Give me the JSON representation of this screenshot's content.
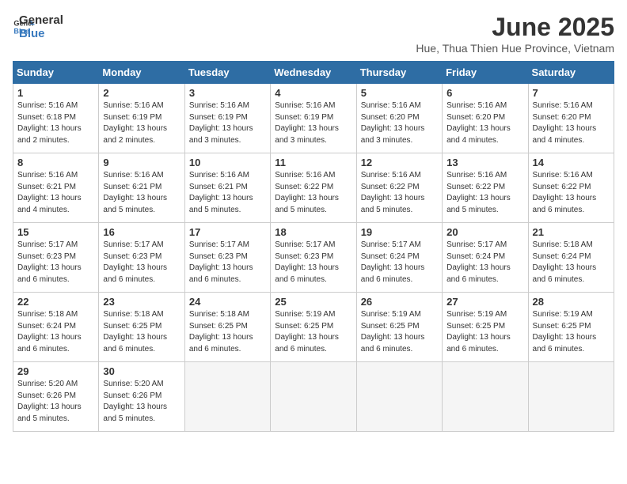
{
  "logo": {
    "general": "General",
    "blue": "Blue"
  },
  "title": "June 2025",
  "location": "Hue, Thua Thien Hue Province, Vietnam",
  "weekdays": [
    "Sunday",
    "Monday",
    "Tuesday",
    "Wednesday",
    "Thursday",
    "Friday",
    "Saturday"
  ],
  "weeks": [
    [
      {
        "day": "1",
        "sunrise": "5:16 AM",
        "sunset": "6:18 PM",
        "daylight": "13 hours and 2 minutes."
      },
      {
        "day": "2",
        "sunrise": "5:16 AM",
        "sunset": "6:19 PM",
        "daylight": "13 hours and 2 minutes."
      },
      {
        "day": "3",
        "sunrise": "5:16 AM",
        "sunset": "6:19 PM",
        "daylight": "13 hours and 3 minutes."
      },
      {
        "day": "4",
        "sunrise": "5:16 AM",
        "sunset": "6:19 PM",
        "daylight": "13 hours and 3 minutes."
      },
      {
        "day": "5",
        "sunrise": "5:16 AM",
        "sunset": "6:20 PM",
        "daylight": "13 hours and 3 minutes."
      },
      {
        "day": "6",
        "sunrise": "5:16 AM",
        "sunset": "6:20 PM",
        "daylight": "13 hours and 4 minutes."
      },
      {
        "day": "7",
        "sunrise": "5:16 AM",
        "sunset": "6:20 PM",
        "daylight": "13 hours and 4 minutes."
      }
    ],
    [
      {
        "day": "8",
        "sunrise": "5:16 AM",
        "sunset": "6:21 PM",
        "daylight": "13 hours and 4 minutes."
      },
      {
        "day": "9",
        "sunrise": "5:16 AM",
        "sunset": "6:21 PM",
        "daylight": "13 hours and 5 minutes."
      },
      {
        "day": "10",
        "sunrise": "5:16 AM",
        "sunset": "6:21 PM",
        "daylight": "13 hours and 5 minutes."
      },
      {
        "day": "11",
        "sunrise": "5:16 AM",
        "sunset": "6:22 PM",
        "daylight": "13 hours and 5 minutes."
      },
      {
        "day": "12",
        "sunrise": "5:16 AM",
        "sunset": "6:22 PM",
        "daylight": "13 hours and 5 minutes."
      },
      {
        "day": "13",
        "sunrise": "5:16 AM",
        "sunset": "6:22 PM",
        "daylight": "13 hours and 5 minutes."
      },
      {
        "day": "14",
        "sunrise": "5:16 AM",
        "sunset": "6:22 PM",
        "daylight": "13 hours and 6 minutes."
      }
    ],
    [
      {
        "day": "15",
        "sunrise": "5:17 AM",
        "sunset": "6:23 PM",
        "daylight": "13 hours and 6 minutes."
      },
      {
        "day": "16",
        "sunrise": "5:17 AM",
        "sunset": "6:23 PM",
        "daylight": "13 hours and 6 minutes."
      },
      {
        "day": "17",
        "sunrise": "5:17 AM",
        "sunset": "6:23 PM",
        "daylight": "13 hours and 6 minutes."
      },
      {
        "day": "18",
        "sunrise": "5:17 AM",
        "sunset": "6:23 PM",
        "daylight": "13 hours and 6 minutes."
      },
      {
        "day": "19",
        "sunrise": "5:17 AM",
        "sunset": "6:24 PM",
        "daylight": "13 hours and 6 minutes."
      },
      {
        "day": "20",
        "sunrise": "5:17 AM",
        "sunset": "6:24 PM",
        "daylight": "13 hours and 6 minutes."
      },
      {
        "day": "21",
        "sunrise": "5:18 AM",
        "sunset": "6:24 PM",
        "daylight": "13 hours and 6 minutes."
      }
    ],
    [
      {
        "day": "22",
        "sunrise": "5:18 AM",
        "sunset": "6:24 PM",
        "daylight": "13 hours and 6 minutes."
      },
      {
        "day": "23",
        "sunrise": "5:18 AM",
        "sunset": "6:25 PM",
        "daylight": "13 hours and 6 minutes."
      },
      {
        "day": "24",
        "sunrise": "5:18 AM",
        "sunset": "6:25 PM",
        "daylight": "13 hours and 6 minutes."
      },
      {
        "day": "25",
        "sunrise": "5:19 AM",
        "sunset": "6:25 PM",
        "daylight": "13 hours and 6 minutes."
      },
      {
        "day": "26",
        "sunrise": "5:19 AM",
        "sunset": "6:25 PM",
        "daylight": "13 hours and 6 minutes."
      },
      {
        "day": "27",
        "sunrise": "5:19 AM",
        "sunset": "6:25 PM",
        "daylight": "13 hours and 6 minutes."
      },
      {
        "day": "28",
        "sunrise": "5:19 AM",
        "sunset": "6:25 PM",
        "daylight": "13 hours and 6 minutes."
      }
    ],
    [
      {
        "day": "29",
        "sunrise": "5:20 AM",
        "sunset": "6:26 PM",
        "daylight": "13 hours and 5 minutes."
      },
      {
        "day": "30",
        "sunrise": "5:20 AM",
        "sunset": "6:26 PM",
        "daylight": "13 hours and 5 minutes."
      },
      null,
      null,
      null,
      null,
      null
    ]
  ]
}
